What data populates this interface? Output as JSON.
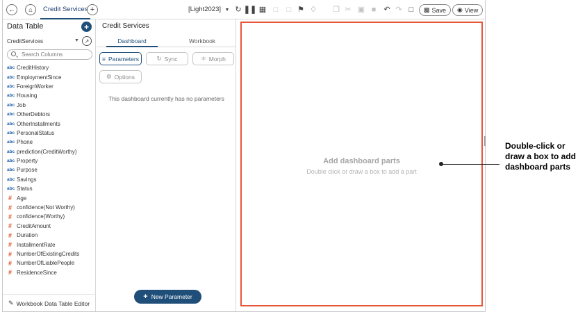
{
  "header": {
    "tab_title": "Credit Services",
    "theme_label": "[Light2023]",
    "save_label": "Save",
    "view_label": "View"
  },
  "data_table": {
    "title": "Data Table",
    "datasource": "CreditServices",
    "search_placeholder": "Search Columns",
    "columns": [
      {
        "type": "abc",
        "name": "CreditHistory"
      },
      {
        "type": "abc",
        "name": "EmploymentSince"
      },
      {
        "type": "abc",
        "name": "ForeignWorker"
      },
      {
        "type": "abc",
        "name": "Housing"
      },
      {
        "type": "abc",
        "name": "Job"
      },
      {
        "type": "abc",
        "name": "OtherDebtors"
      },
      {
        "type": "abc",
        "name": "OtherInstallments"
      },
      {
        "type": "abc",
        "name": "PersonalStatus"
      },
      {
        "type": "abc",
        "name": "Phone"
      },
      {
        "type": "abc",
        "name": "prediction(CreditWorthy)"
      },
      {
        "type": "abc",
        "name": "Property"
      },
      {
        "type": "abc",
        "name": "Purpose"
      },
      {
        "type": "abc",
        "name": "Savings"
      },
      {
        "type": "abc",
        "name": "Status"
      },
      {
        "type": "#",
        "name": "Age"
      },
      {
        "type": "#",
        "name": "confidence(Not Worthy)"
      },
      {
        "type": "#",
        "name": "confidence(Worthy)"
      },
      {
        "type": "#",
        "name": "CreditAmount"
      },
      {
        "type": "#",
        "name": "Duration"
      },
      {
        "type": "#",
        "name": "InstallmentRate"
      },
      {
        "type": "#",
        "name": "NumberOfExistingCredits"
      },
      {
        "type": "#",
        "name": "NumberOfLiablePeople"
      },
      {
        "type": "#",
        "name": "ResidenceSince"
      }
    ],
    "editor_label": "Workbook Data Table Editor"
  },
  "dashboard_panel": {
    "title": "Credit Services",
    "tabs": [
      "Dashboard",
      "Workbook"
    ],
    "active_tab": "Dashboard",
    "chips": {
      "parameters": "Parameters",
      "sync": "Sync",
      "morph": "Morph",
      "options": "Options"
    },
    "empty_message": "This dashboard currently has no parameters",
    "new_parameter_label": "New Parameter"
  },
  "canvas": {
    "title": "Add dashboard parts",
    "subtitle": "Double click or draw a box to add a part",
    "border_color": "#e8553a"
  },
  "callout": {
    "text": "Double-click or draw a box to add dashboard parts"
  },
  "colors": {
    "accent": "#1f4e79",
    "text_type": "#1f5fa8",
    "numeric_type": "#e0542b"
  }
}
